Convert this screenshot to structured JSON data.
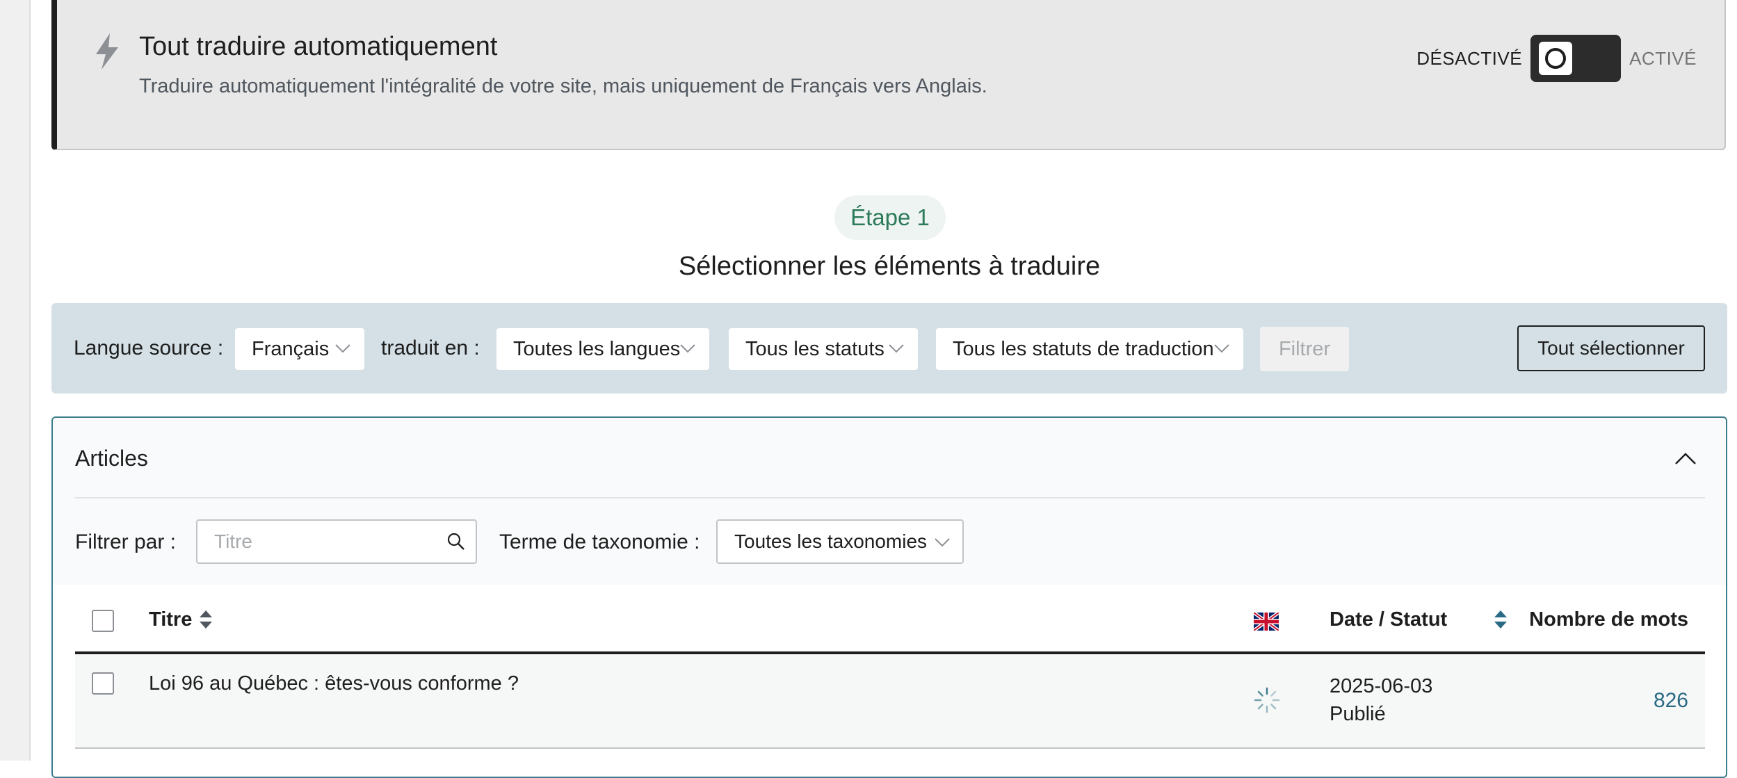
{
  "auto_translate": {
    "title": "Tout traduire automatiquement",
    "description": "Traduire automatiquement l'intégralité de votre site, mais uniquement de Français vers Anglais.",
    "toggle_off_label": "DÉSACTIVÉ",
    "toggle_on_label": "ACTIVÉ",
    "toggle_state": "off",
    "icon": "bolt-icon"
  },
  "step": {
    "label": "Étape 1",
    "title": "Sélectionner les éléments à traduire"
  },
  "filter_bar": {
    "source_language_label": "Langue source :",
    "source_language_value": "Français",
    "translated_to_label": "traduit en :",
    "target_language_value": "Toutes les langues",
    "status_value": "Tous les statuts",
    "translation_status_value": "Tous les statuts de traduction",
    "filter_button": "Filtrer",
    "select_all_button": "Tout sélectionner"
  },
  "articles": {
    "title": "Articles",
    "filter_by_label": "Filtrer par :",
    "search_placeholder": "Titre",
    "taxonomy_label": "Terme de taxonomie :",
    "taxonomy_value": "Toutes les taxonomies",
    "columns": {
      "title": "Titre",
      "date_status": "Date / Statut",
      "word_count": "Nombre de mots"
    },
    "rows": [
      {
        "title": "Loi 96 au Québec : êtes-vous conforme ?",
        "date": "2025-06-03",
        "status": "Publié",
        "word_count": "826"
      }
    ]
  },
  "colors": {
    "accent_green": "#2c7a5a",
    "panel_border": "#3c7c8c",
    "link_blue": "#2a6a85",
    "filter_bar_bg": "#d4e0e6"
  }
}
